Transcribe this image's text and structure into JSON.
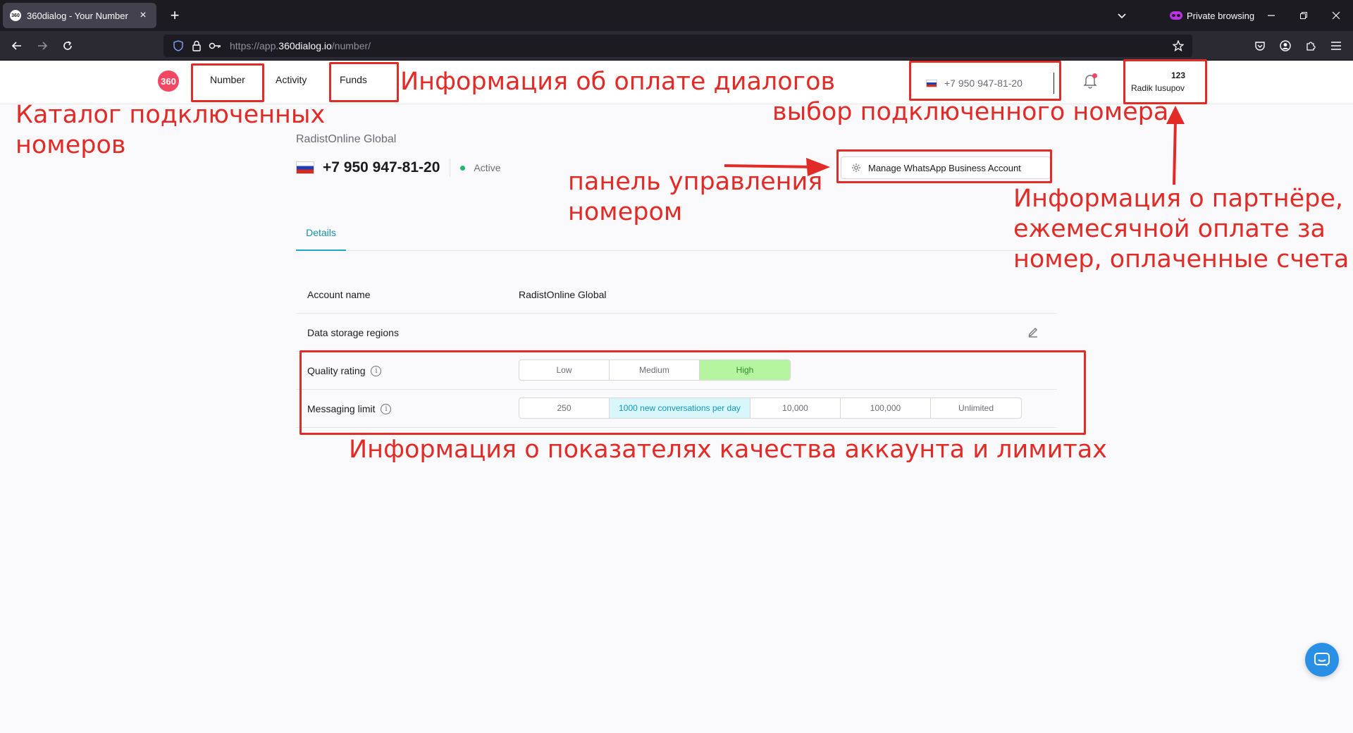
{
  "browser": {
    "tab_title": "360dialog - Your Number",
    "tab_favicon": "360",
    "private_label": "Private browsing",
    "url_prefix": "https://app.",
    "url_domain": "360dialog.io",
    "url_path": "/number/"
  },
  "header": {
    "logo": "360",
    "nav": [
      {
        "label": "Number"
      },
      {
        "label": "Activity"
      },
      {
        "label": "Funds"
      }
    ],
    "selected_phone": "+7 950 947-81-20",
    "partner_number": "123",
    "partner_name": "Radik Iusupov"
  },
  "number": {
    "account_name": "RadistOnline Global",
    "phone": "+7 950 947-81-20",
    "status": "Active",
    "manage_button": "Manage WhatsApp Business Account"
  },
  "tabs": {
    "details": "Details"
  },
  "details": {
    "account_name_label": "Account name",
    "account_name_value": "RadistOnline Global",
    "storage_label": "Data storage regions",
    "quality_label": "Quality rating",
    "quality_options": [
      "Low",
      "Medium",
      "High"
    ],
    "quality_selected": "High",
    "limit_label": "Messaging limit",
    "limit_options": [
      "250",
      "1000 new conversations per day",
      "10,000",
      "100,000",
      "Unlimited"
    ],
    "limit_selected": "1000 new conversations per day"
  },
  "annotations": {
    "catalog_line1": "Каталог подключенных",
    "catalog_line2": "номеров",
    "funds": "Информация об оплате диалогов",
    "number_select": "выбор подключенного номера",
    "panel_line1": "панель управления",
    "panel_line2": "номером",
    "partner_line1": "Информация о партнёре,",
    "partner_line2": "ежемесячной оплате за",
    "partner_line3": "номер, оплаченные счета",
    "quality": "Информация о показателях качества аккаунта и лимитах"
  },
  "colors": {
    "annotation": "#e22b26",
    "brand": "#f24663",
    "accent": "#1fa8c2",
    "status_active": "#1fb86b",
    "quality_high": "#b6f5a0"
  }
}
